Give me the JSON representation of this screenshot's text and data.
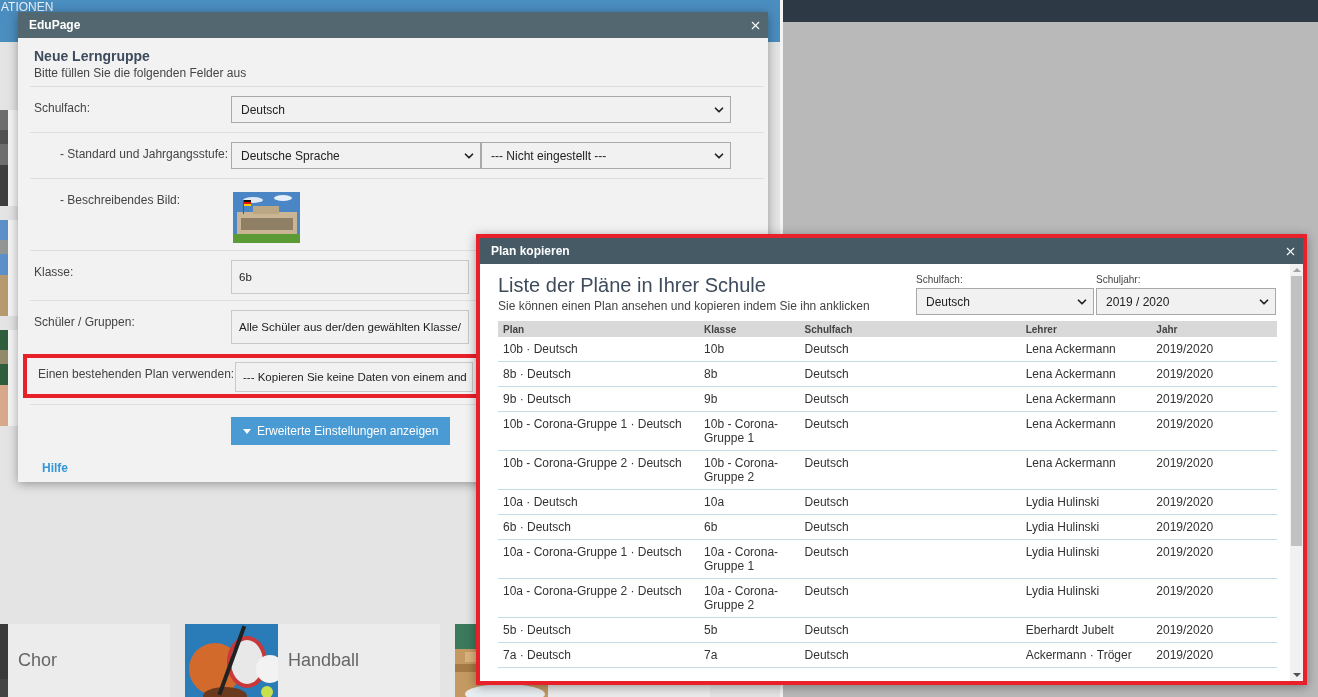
{
  "background": {
    "header_text": "ATIONEN",
    "cards": [
      {
        "kind": "labeled",
        "label": "Chor"
      },
      {
        "kind": "labeled",
        "label": "Handball"
      },
      {
        "kind": "picture"
      }
    ]
  },
  "dialog": {
    "title": "EduPage",
    "heading": "Neue Lerngruppe",
    "subtitle": "Bitte füllen Sie die folgenden Felder aus",
    "rows": [
      {
        "kind": "select",
        "label": "Schulfach:",
        "indent": false,
        "highlighted": false,
        "values": [
          "Deutsch"
        ]
      },
      {
        "kind": "select-pair",
        "label": "- Standard und Jahrgangsstufe:",
        "indent": true,
        "highlighted": false,
        "values": [
          "Deutsche Sprache",
          "--- Nicht eingestellt ---"
        ]
      },
      {
        "kind": "picture",
        "label": "- Beschreibendes Bild:",
        "indent": true,
        "highlighted": false
      },
      {
        "kind": "field",
        "label": "Klasse:",
        "indent": false,
        "highlighted": false,
        "values": [
          "6b"
        ]
      },
      {
        "kind": "field",
        "label": "Schüler / Gruppen:",
        "indent": false,
        "highlighted": false,
        "values": [
          "Alle Schüler aus der/den gewählten Klasse/"
        ]
      },
      {
        "kind": "field",
        "label": "Einen bestehenden Plan verwenden:",
        "indent": false,
        "highlighted": true,
        "values": [
          "--- Kopieren Sie keine Daten von einem and"
        ]
      }
    ],
    "button": "Erweiterte Einstellungen anzeigen",
    "help_link": "Hilfe"
  },
  "copy_dialog": {
    "title": "Plan kopieren",
    "heading": "Liste der Pläne in Ihrer Schule",
    "subtitle": "Sie können einen Plan ansehen und kopieren indem Sie ihn anklicken",
    "filters": [
      {
        "label": "Schulfach:",
        "value": "Deutsch"
      },
      {
        "label": "Schuljahr:",
        "value": "2019 / 2020"
      }
    ],
    "table": {
      "columns": [
        "Plan",
        "Klasse",
        "Schulfach",
        "Lehrer",
        "Jahr"
      ],
      "rows": [
        [
          "10b · Deutsch",
          "10b",
          "Deutsch",
          "Lena Ackermann",
          "2019/2020"
        ],
        [
          "8b · Deutsch",
          "8b",
          "Deutsch",
          "Lena Ackermann",
          "2019/2020"
        ],
        [
          "9b · Deutsch",
          "9b",
          "Deutsch",
          "Lena Ackermann",
          "2019/2020"
        ],
        [
          "10b - Corona-Gruppe 1 · Deutsch",
          "10b - Corona-Gruppe 1",
          "Deutsch",
          "Lena Ackermann",
          "2019/2020"
        ],
        [
          "10b - Corona-Gruppe 2 · Deutsch",
          "10b - Corona-Gruppe 2",
          "Deutsch",
          "Lena Ackermann",
          "2019/2020"
        ],
        [
          "10a · Deutsch",
          "10a",
          "Deutsch",
          "Lydia Hulinski",
          "2019/2020"
        ],
        [
          "6b · Deutsch",
          "6b",
          "Deutsch",
          "Lydia Hulinski",
          "2019/2020"
        ],
        [
          "10a - Corona-Gruppe 1 · Deutsch",
          "10a - Corona-Gruppe 1",
          "Deutsch",
          "Lydia Hulinski",
          "2019/2020"
        ],
        [
          "10a - Corona-Gruppe 2 · Deutsch",
          "10a - Corona-Gruppe 2",
          "Deutsch",
          "Lydia Hulinski",
          "2019/2020"
        ],
        [
          "5b · Deutsch",
          "5b",
          "Deutsch",
          "Eberhardt Jubelt",
          "2019/2020"
        ],
        [
          "7a · Deutsch",
          "7a",
          "Deutsch",
          "Ackermann · Tröger",
          "2019/2020"
        ]
      ]
    }
  }
}
